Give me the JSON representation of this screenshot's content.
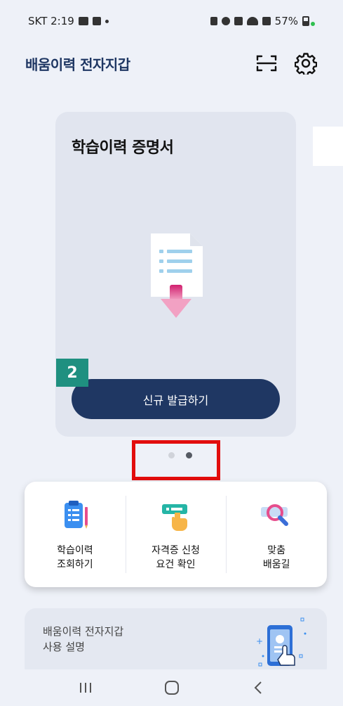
{
  "status_bar": {
    "carrier_time": "SKT 2:19",
    "battery": "57%"
  },
  "header": {
    "title": "배움이력 전자지갑",
    "icons": [
      "qr-scan-icon",
      "gear-icon"
    ]
  },
  "card": {
    "title": "학습이력 증명서",
    "button_label": "신규 발급하기",
    "illustration": "document-download-icon"
  },
  "step_badge": "2",
  "pager": {
    "count": 2,
    "active_index": 1
  },
  "quick_menu": [
    {
      "label": "학습이력\n조회하기",
      "icon": "clipboard-icon"
    },
    {
      "label": "자격증 신청\n요건 확인",
      "icon": "card-tap-icon"
    },
    {
      "label": "맞춤\n배움길",
      "icon": "magnifier-icon"
    }
  ],
  "guide": {
    "text": "배움이력 전자지갑\n사용 설명",
    "illustration": "phone-tap-icon"
  },
  "colors": {
    "primary": "#1f3763",
    "background": "#eef1f8",
    "highlight": "#e20d0d",
    "badge": "#1f9080"
  }
}
